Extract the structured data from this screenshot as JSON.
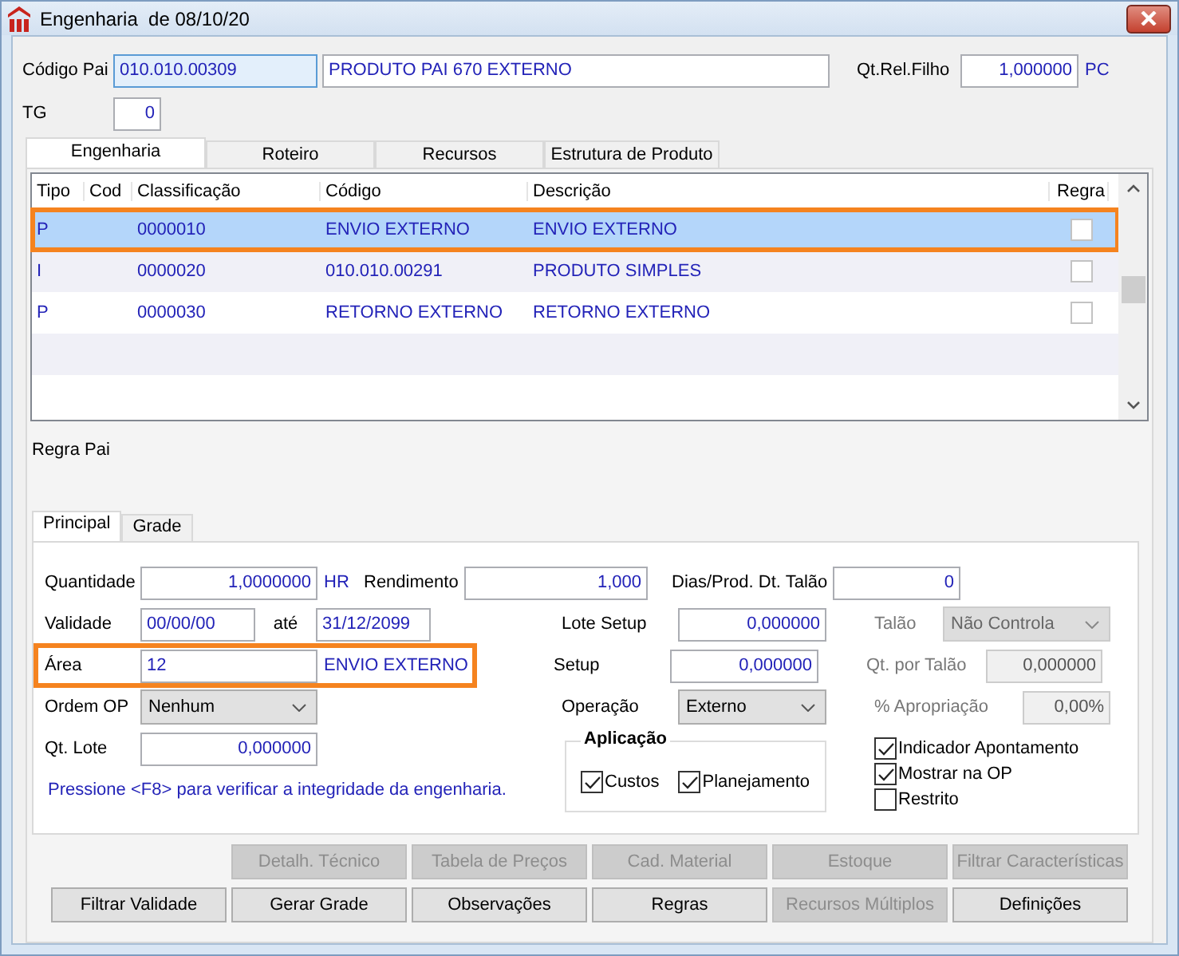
{
  "window": {
    "title": "Engenharia  de 08/10/20"
  },
  "header": {
    "codigo_pai_label": "Código Pai",
    "codigo_pai_value": "010.010.00309",
    "descricao": "PRODUTO PAI 670 EXTERNO",
    "qt_label": "Qt.Rel.Filho",
    "qt_value": "1,000000",
    "unit": "PC",
    "tg_label": "TG",
    "tg_value": "0"
  },
  "tabs": [
    {
      "label": "Engenharia",
      "selected": true
    },
    {
      "label": "Roteiro",
      "selected": false
    },
    {
      "label": "Recursos",
      "selected": false
    },
    {
      "label": "Estrutura de Produto",
      "selected": false
    }
  ],
  "grid": {
    "columns": [
      "Tipo",
      "Cod",
      "Classificação",
      "Código",
      "Descrição",
      "Regra"
    ],
    "rows": [
      {
        "tipo": "P",
        "classificacao": "0000010",
        "codigo": "ENVIO EXTERNO",
        "descricao": "ENVIO EXTERNO",
        "regra": false,
        "selected": true,
        "highlighted": true
      },
      {
        "tipo": "I",
        "classificacao": "0000020",
        "codigo": "010.010.00291",
        "descricao": "PRODUTO SIMPLES",
        "regra": false,
        "selected": false,
        "highlighted": false
      },
      {
        "tipo": "P",
        "classificacao": "0000030",
        "codigo": "RETORNO EXTERNO",
        "descricao": "RETORNO EXTERNO",
        "regra": false,
        "selected": false,
        "highlighted": false
      }
    ]
  },
  "regra_pai_label": "Regra Pai",
  "subtabs": [
    {
      "label": "Principal",
      "selected": true
    },
    {
      "label": "Grade",
      "selected": false
    }
  ],
  "form": {
    "quantidade": {
      "label": "Quantidade",
      "value": "1,0000000",
      "unit": "HR"
    },
    "rendimento": {
      "label": "Rendimento",
      "value": "1,000"
    },
    "dias": {
      "label": "Dias/Prod. Dt. Talão",
      "value": "0"
    },
    "validade": {
      "label": "Validade",
      "from": "00/00/00",
      "to_label": "até",
      "to": "31/12/2099"
    },
    "lote_setup": {
      "label": "Lote Setup",
      "value": "0,000000"
    },
    "talao": {
      "label": "Talão",
      "value": "Não Controla",
      "disabled": true
    },
    "area": {
      "label": "Área",
      "code": "12",
      "name": "ENVIO EXTERNO",
      "highlighted": true
    },
    "setup": {
      "label": "Setup",
      "value": "0,000000"
    },
    "qt_por_talao": {
      "label": "Qt. por Talão",
      "value": "0,000000",
      "disabled": true
    },
    "ordem_op": {
      "label": "Ordem OP",
      "value": "Nenhum"
    },
    "operacao": {
      "label": "Operação",
      "value": "Externo"
    },
    "apropriacao": {
      "label": "% Apropriação",
      "value": "0,00%",
      "disabled": true
    },
    "qt_lote": {
      "label": "Qt. Lote",
      "value": "0,000000"
    }
  },
  "aplicacao": {
    "title": "Aplicação",
    "options": [
      {
        "label": "Custos",
        "checked": true
      },
      {
        "label": "Planejamento",
        "checked": true
      }
    ]
  },
  "flags": [
    {
      "label": "Indicador Apontamento",
      "checked": true
    },
    {
      "label": "Mostrar na OP",
      "checked": true
    },
    {
      "label": "Restrito",
      "checked": false
    }
  ],
  "hint": "Pressione <F8> para verificar a integridade da engenharia.",
  "button_rows": [
    [
      {
        "label": "Detalh. Técnico",
        "disabled": true
      },
      {
        "label": "Tabela de Preços",
        "disabled": true
      },
      {
        "label": "Cad. Material",
        "disabled": true
      },
      {
        "label": "Estoque",
        "disabled": true
      },
      {
        "label": "Filtrar Características",
        "disabled": true
      }
    ],
    [
      {
        "label": "Filtrar Validade",
        "disabled": false
      },
      {
        "label": "Gerar Grade",
        "disabled": false
      },
      {
        "label": "Observações",
        "disabled": false
      },
      {
        "label": "Regras",
        "disabled": false
      },
      {
        "label": "Recursos Múltiplos",
        "disabled": true
      },
      {
        "label": "Definições",
        "disabled": false
      }
    ]
  ]
}
